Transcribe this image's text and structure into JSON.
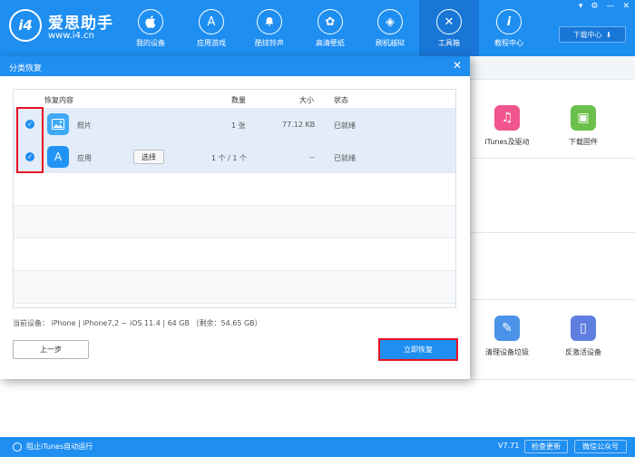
{
  "app": {
    "brand_name": "爱思助手",
    "brand_url": "www.i4.cn",
    "logo_text": "i4"
  },
  "nav": [
    {
      "label": "我的设备",
      "icon": "apple-icon",
      "glyph": ""
    },
    {
      "label": "应用游戏",
      "icon": "app-store-icon",
      "glyph": "A"
    },
    {
      "label": "酷炫铃声",
      "icon": "bell-icon",
      "glyph": "🔔"
    },
    {
      "label": "高清壁纸",
      "icon": "flower-icon",
      "glyph": "✿"
    },
    {
      "label": "刷机越狱",
      "icon": "box-icon",
      "glyph": "◈"
    },
    {
      "label": "工具箱",
      "icon": "tools-icon",
      "glyph": "✕",
      "active": true
    },
    {
      "label": "教程中心",
      "icon": "info-icon",
      "glyph": "i"
    }
  ],
  "header": {
    "download_center": "下载中心"
  },
  "background_tools": [
    {
      "label": "iTunes及驱动",
      "icon": "itunes-music-icon",
      "color": "#f0568d",
      "glyph": "♫"
    },
    {
      "label": "下载固件",
      "icon": "cube-icon",
      "color": "#6bc04b",
      "glyph": "▣"
    },
    {
      "label": "清理设备垃圾",
      "icon": "broom-icon",
      "color": "#4b93e8",
      "glyph": "✎"
    },
    {
      "label": "反激活设备",
      "icon": "phone-icon",
      "color": "#5f7fe0",
      "glyph": "▯"
    }
  ],
  "modal": {
    "title": "分类恢复",
    "close_glyph": "✕",
    "columns": {
      "content": "恢复内容",
      "count": "数量",
      "size": "大小",
      "status": "状态"
    },
    "rows": [
      {
        "name": "照片",
        "icon": "photo-icon",
        "glyph": "▨",
        "count": "1 张",
        "size": "77.12 KB",
        "status": "已就绪",
        "checked": true
      },
      {
        "name": "应用",
        "icon": "app-store-icon",
        "glyph": "A",
        "count": "1 个 / 1 个",
        "size": "--",
        "status": "已就绪",
        "checked": true,
        "select_label": "选择"
      }
    ],
    "device_info": "当前设备： iPhone   |   iPhone7,2 ~ iOS 11.4   |   64 GB （剩余：54.65 GB）",
    "prev_button": "上一步",
    "restore_button": "立即恢复"
  },
  "statusbar": {
    "itunes_autorun": "阻止iTunes自动运行",
    "version": "V7.71",
    "check_update": "检查更新",
    "wechat": "微信公众号"
  },
  "colors": {
    "primary": "#1e8ef1",
    "highlight_red": "#e81123",
    "row_selected": "#e3edf9"
  }
}
